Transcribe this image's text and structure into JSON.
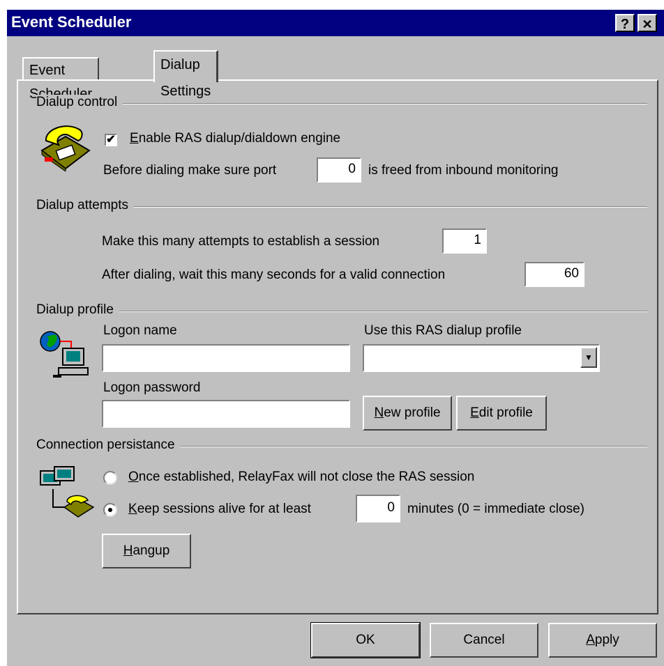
{
  "window": {
    "title": "Event Scheduler",
    "help_glyph": "?",
    "close_glyph": "✕"
  },
  "tabs": [
    {
      "label": "Event Scheduler",
      "active": false
    },
    {
      "label": "Dialup Settings",
      "active": true
    }
  ],
  "dialup_control": {
    "heading": "Dialup control",
    "icon": "telephone-icon",
    "enable_checkbox": {
      "checked": true,
      "check_glyph": "✔",
      "label_accel": "E",
      "label_rest": "nable RAS dialup/dialdown engine"
    },
    "port_prefix": "Before dialing make sure port",
    "port_value": "0",
    "port_suffix": "is freed from inbound monitoring"
  },
  "dialup_attempts": {
    "heading": "Dialup attempts",
    "attempts_label": "Make this many attempts to establish a session",
    "attempts_value": "1",
    "wait_label": "After dialing, wait this many seconds for a valid connection",
    "wait_value": "60"
  },
  "dialup_profile": {
    "heading": "Dialup profile",
    "icon": "network-globe-computer-icon",
    "logon_name_label": "Logon name",
    "logon_name_value": "",
    "ras_profile_label": "Use this RAS dialup profile",
    "ras_profile_value": "",
    "logon_password_label": "Logon password",
    "logon_password_value": "",
    "new_profile": {
      "accel": "N",
      "rest": "ew profile"
    },
    "edit_profile": {
      "accel": "E",
      "rest": "dit profile"
    }
  },
  "connection_persistance": {
    "heading": "Connection persistance",
    "icon": "networked-computers-phone-icon",
    "option_once": {
      "accel": "O",
      "rest": "nce established, RelayFax will not close the RAS session",
      "selected": false
    },
    "option_keep": {
      "accel": "K",
      "rest": "eep sessions alive for at least",
      "selected": true
    },
    "minutes_value": "0",
    "minutes_suffix": "minutes (0 = immediate close)",
    "hangup": {
      "accel": "H",
      "rest": "angup"
    }
  },
  "footer": {
    "ok_label": "OK",
    "cancel_label": "Cancel",
    "apply": {
      "accel": "A",
      "rest": "pply"
    }
  },
  "colors": {
    "titlebar": "#000080",
    "face": "#c0c0c0"
  }
}
